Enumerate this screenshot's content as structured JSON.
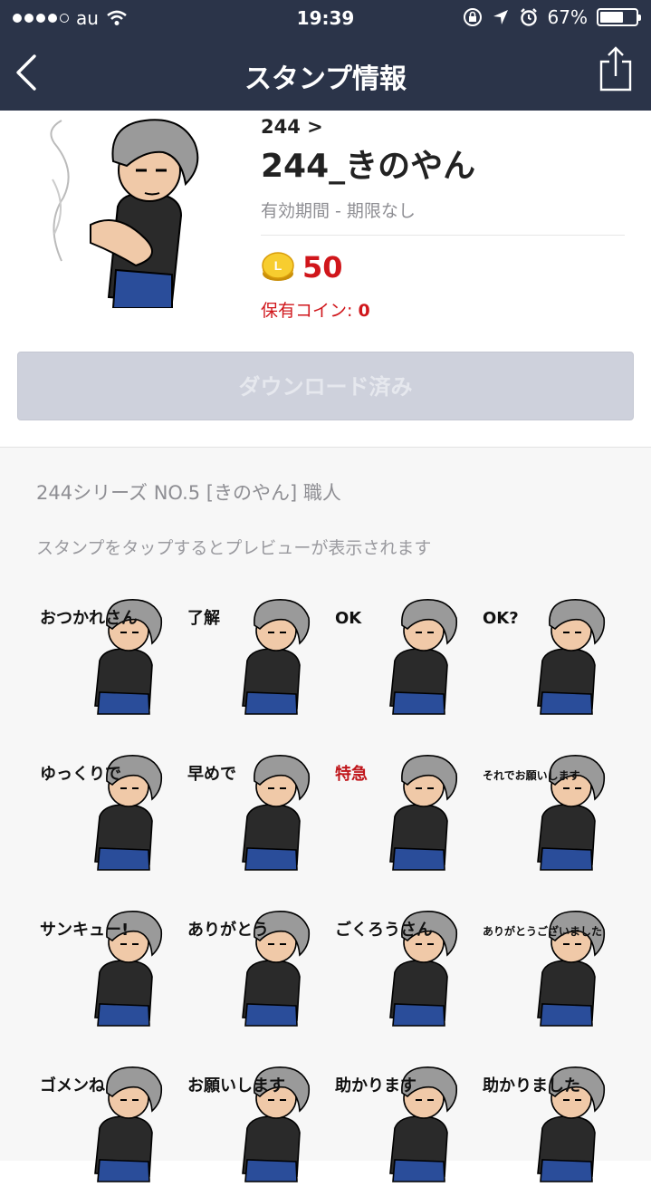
{
  "status_bar": {
    "carrier": "au",
    "time": "19:39",
    "battery_percent": "67%",
    "battery_level": 0.67
  },
  "nav": {
    "title": "スタンプ情報"
  },
  "sticker_info": {
    "author": "244 >",
    "name": "244_きのやん",
    "validity": "有効期間 - 期限なし",
    "price": "50",
    "owned_label": "保有コイン: ",
    "owned_value": "0",
    "download_button": "ダウンロード済み"
  },
  "description": {
    "series": "244シリーズ NO.5 [きのやん] 職人",
    "hint": "スタンプをタップするとプレビューが表示されます"
  },
  "stickers": [
    {
      "text": "おつかれさん"
    },
    {
      "text": "了解"
    },
    {
      "text": "OK"
    },
    {
      "text": "OK?"
    },
    {
      "text": "ゆっくりで"
    },
    {
      "text": "早めで"
    },
    {
      "text": "特急"
    },
    {
      "text": "それでお願いします"
    },
    {
      "text": "サンキュー!"
    },
    {
      "text": "ありがとう"
    },
    {
      "text": "ごくろうさん"
    },
    {
      "text": "ありがとうございました"
    },
    {
      "text": "ゴメンね"
    },
    {
      "text": "お願いします"
    },
    {
      "text": "助かります"
    },
    {
      "text": "助かりました"
    }
  ],
  "colors": {
    "nav_bg": "#2b3449",
    "price_red": "#d0161b",
    "button_disabled": "#ced1dc"
  }
}
